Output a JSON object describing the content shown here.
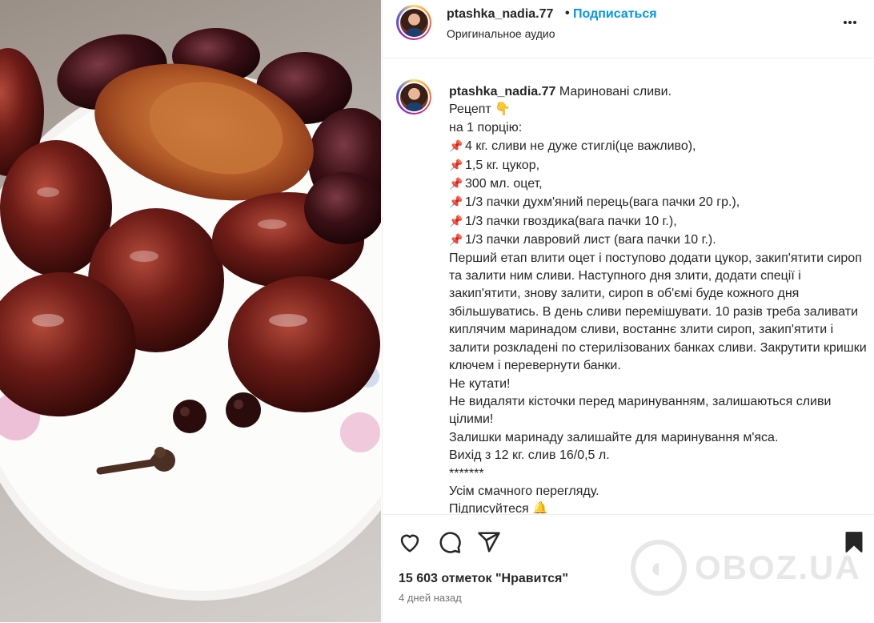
{
  "post": {
    "username": "ptashka_nadia.77",
    "separator": "•",
    "follow_label": "Подписаться",
    "audio_label": "Оригинальное аудио",
    "more_label": "•••"
  },
  "caption": {
    "username": "ptashka_nadia.77",
    "title": "Мариновані сливи.",
    "recipe_label": "Рецепт",
    "recipe_emoji": "👇",
    "portion": "на 1 порцію:",
    "pin_emoji": "📌",
    "ingredients": [
      "4 кг. сливи не дуже стиглі(це важливо),",
      "1,5 кг. цукор,",
      "300 мл. оцет,",
      "1/3 пачки духм'яний перець(вага пачки 20 гр.),",
      "1/3 пачки гвоздика(вага пачки 10 г.),",
      "1/3 пачки лавровий лист (вага пачки 10 г.)."
    ],
    "instructions": "Перший етап влити оцет і поступово додати цукор, закип'ятити сироп та залити ним сливи. Наступного дня злити, додати спеції і закип'ятити, знову залити, сироп в об'ємі буде кожного дня збільшуватись. В день сливи перемішувати. 10 разів треба заливати киплячим маринадом сливи, востаннє злити сироп, закип'ятити і залити розкладені по стерилізованих банках сливи. Закрутити кришки ключем і перевернути банки.",
    "no_wrap": "Не кутати!",
    "pits": "Не видаляти кісточки перед маринуванням, залишаються сливи цілими!",
    "leftover": "Залишки маринаду залишайте для маринування м'яса.",
    "yield": "Вихід з 12 кг. слив 16/0,5 л.",
    "stars": "*******",
    "enjoy": "Усім смачного перегляду.",
    "subscribe": "Підписуйтеся",
    "bell_emoji": "🔔"
  },
  "footer": {
    "likes_text": "15 603 отметок \"Нравится\"",
    "time_text": "4 дней назад",
    "watermark_text": "OBOZ.UA"
  },
  "colors": {
    "follow": "#0095f6",
    "text": "#262626",
    "muted": "#737373"
  },
  "icons": [
    "heart-icon",
    "comment-icon",
    "share-icon",
    "bookmark-icon",
    "more-icon",
    "pin-icon",
    "bell-icon"
  ]
}
